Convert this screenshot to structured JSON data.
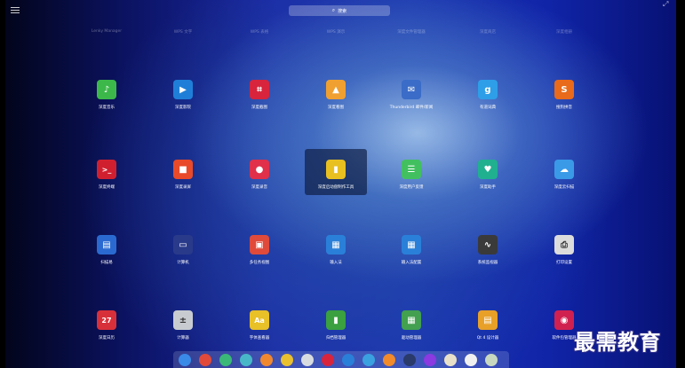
{
  "search": {
    "placeholder": "搜索",
    "icon": "search-icon"
  },
  "categories": [
    "Lenky Manager",
    "WPS 文字",
    "WPS 表格",
    "WPS 演示",
    "深度文件管理器",
    "深度商店",
    "深度相册"
  ],
  "apps": [
    {
      "label": "深度音乐",
      "icon": "music-icon",
      "color": "#3cb84a",
      "glyph": "♪"
    },
    {
      "label": "深度影院",
      "icon": "video-player-icon",
      "color": "#1f7fd8",
      "glyph": "▶"
    },
    {
      "label": "深度截图",
      "icon": "screenshot-icon",
      "color": "#d8243c",
      "glyph": "⌗"
    },
    {
      "label": "深度看图",
      "icon": "image-viewer-icon",
      "color": "#f0a030",
      "glyph": "▲"
    },
    {
      "label": "Thunderbird 邮件/新闻",
      "icon": "thunderbird-icon",
      "color": "#3a6cc8",
      "glyph": "✉"
    },
    {
      "label": "有道词典",
      "icon": "dictionary-icon",
      "color": "#2e9ee8",
      "glyph": "g"
    },
    {
      "label": "搜狗拼音",
      "icon": "sogou-input-icon",
      "color": "#e86a1a",
      "glyph": "S"
    },
    {
      "label": "深度终端",
      "icon": "terminal-icon",
      "color": "#d02030",
      "glyph": ">_"
    },
    {
      "label": "深度录屏",
      "icon": "screen-recorder-icon",
      "color": "#e84a2a",
      "glyph": "■"
    },
    {
      "label": "深度录音",
      "icon": "voice-recorder-icon",
      "color": "#e0304a",
      "glyph": "●"
    },
    {
      "label": "深度启动盘制作工具",
      "icon": "boot-maker-icon",
      "color": "#e8c020",
      "glyph": "▮"
    },
    {
      "label": "深度用户反馈",
      "icon": "feedback-icon",
      "color": "#42c060",
      "glyph": "☰"
    },
    {
      "label": "深度助手",
      "icon": "assistant-icon",
      "color": "#20b090",
      "glyph": "♥"
    },
    {
      "label": "深度云扫描",
      "icon": "cloud-scan-icon",
      "color": "#3a9ae8",
      "glyph": "☁"
    },
    {
      "label": "扫描易",
      "icon": "scanner-icon",
      "color": "#2a6ad0",
      "glyph": "▤"
    },
    {
      "label": "计算机",
      "icon": "computer-icon",
      "color": "#2a3a8a",
      "glyph": "▭"
    },
    {
      "label": "多任务视图",
      "icon": "multitask-icon",
      "color": "#e04a3a",
      "glyph": "▣"
    },
    {
      "label": "输入法",
      "icon": "input-method-icon",
      "color": "#2a80d8",
      "glyph": "▦"
    },
    {
      "label": "输入法配置",
      "icon": "input-config-icon",
      "color": "#2a80d8",
      "glyph": "▦"
    },
    {
      "label": "系统监视器",
      "icon": "system-monitor-icon",
      "color": "#3a3a3a",
      "glyph": "∿"
    },
    {
      "label": "打印设置",
      "icon": "printer-icon",
      "color": "#dcdcdc",
      "glyph": "⎙"
    },
    {
      "label": "深度日历",
      "icon": "calendar-icon",
      "color": "#d8303a",
      "glyph": "27"
    },
    {
      "label": "计算器",
      "icon": "calculator-icon",
      "color": "#c8ccd0",
      "glyph": "±"
    },
    {
      "label": "字体查看器",
      "icon": "font-viewer-icon",
      "color": "#e8c028",
      "glyph": "Aa"
    },
    {
      "label": "归档管理器",
      "icon": "archive-manager-icon",
      "color": "#3aa040",
      "glyph": "▮"
    },
    {
      "label": "驱动管理器",
      "icon": "driver-manager-icon",
      "color": "#42a050",
      "glyph": "▦"
    },
    {
      "label": "Qt 4 设计器",
      "icon": "qt-designer-icon",
      "color": "#e8a028",
      "glyph": "▤"
    },
    {
      "label": "软件包管理器",
      "icon": "package-manager-icon",
      "color": "#d02050",
      "glyph": "◉"
    }
  ],
  "selected_index": 10,
  "dock": [
    {
      "icon": "launcher-icon",
      "color": "#3a8ae8"
    },
    {
      "icon": "multitask-icon",
      "color": "#e04a3a"
    },
    {
      "icon": "desktop-icon",
      "color": "#3ab878"
    },
    {
      "icon": "file-manager-icon",
      "color": "#48b8c8"
    },
    {
      "icon": "app-store-icon",
      "color": "#f08830"
    },
    {
      "icon": "chrome-icon",
      "color": "#e8c030"
    },
    {
      "icon": "settings-icon",
      "color": "#d8dce0"
    },
    {
      "icon": "screenshot-icon",
      "color": "#d8243c"
    },
    {
      "icon": "video-player-icon",
      "color": "#2a7fd8"
    },
    {
      "icon": "image-viewer-icon",
      "color": "#3aa0e0"
    },
    {
      "icon": "downloader-icon",
      "color": "#f08a2a"
    },
    {
      "icon": "camera-icon",
      "color": "#2a3a6a"
    },
    {
      "icon": "shutdown-icon",
      "color": "#8a3ae0"
    },
    {
      "icon": "clock-icon",
      "color": "#e8e0c8"
    },
    {
      "icon": "clipboard-icon",
      "color": "#f0f0f0"
    },
    {
      "icon": "trash-icon",
      "color": "#c8d8c0"
    }
  ],
  "watermark": "最需教育"
}
